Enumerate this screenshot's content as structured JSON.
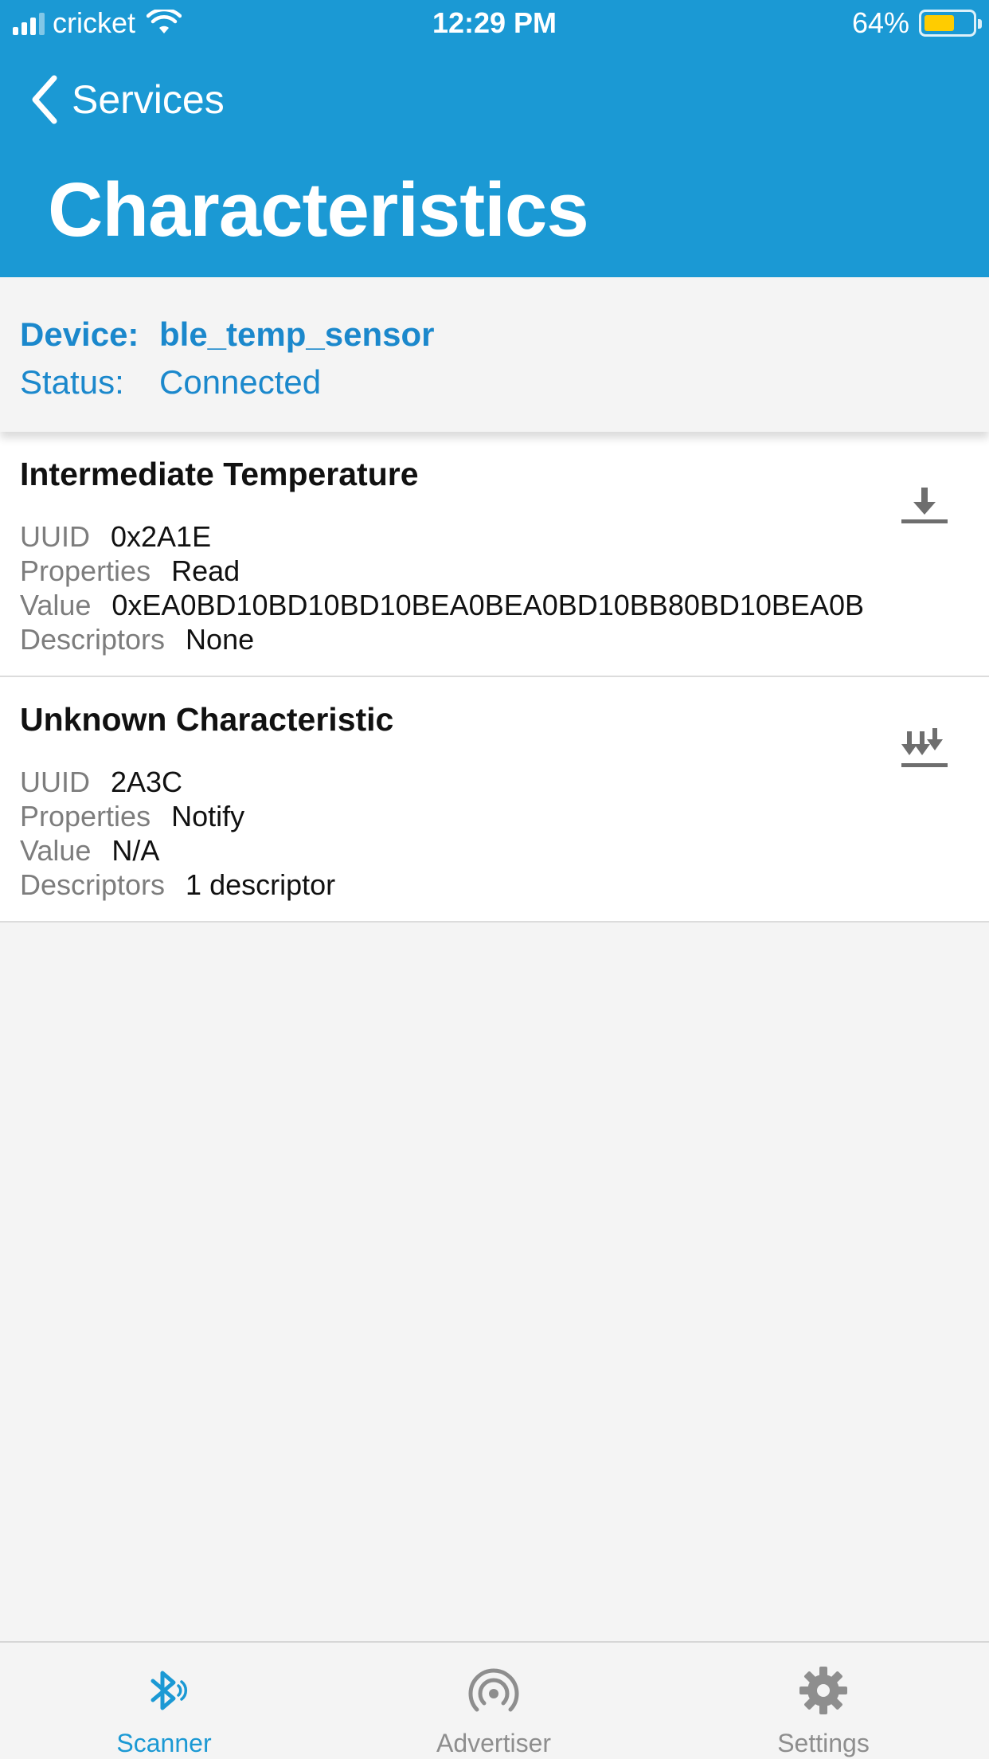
{
  "status_bar": {
    "carrier": "cricket",
    "time": "12:29 PM",
    "battery": "64%",
    "battery_level": 0.64
  },
  "nav": {
    "back_label": "Services",
    "title": "Characteristics"
  },
  "device": {
    "device_label": "Device:",
    "device_value": "ble_temp_sensor",
    "status_label": "Status:",
    "status_value": "Connected"
  },
  "characteristics": [
    {
      "name": "Intermediate Temperature",
      "uuid_label": "UUID",
      "uuid": "0x2A1E",
      "properties_label": "Properties",
      "properties": "Read",
      "value_label": "Value",
      "value": "0xEA0BD10BD10BD10BEA0BEA0BD10BB80BD10BEA0B",
      "descriptors_label": "Descriptors",
      "descriptors": "None",
      "action_icon": "download-icon"
    },
    {
      "name": "Unknown Characteristic",
      "uuid_label": "UUID",
      "uuid": "2A3C",
      "properties_label": "Properties",
      "properties": "Notify",
      "value_label": "Value",
      "value": "N/A",
      "descriptors_label": "Descriptors",
      "descriptors": "1 descriptor",
      "action_icon": "notify-download-icon"
    }
  ],
  "tabs": [
    {
      "label": "Scanner",
      "icon": "bluetooth-icon",
      "active": true
    },
    {
      "label": "Advertiser",
      "icon": "broadcast-icon",
      "active": false
    },
    {
      "label": "Settings",
      "icon": "gear-icon",
      "active": false
    }
  ],
  "colors": {
    "header": "#1b99d4",
    "accent_text": "#1b88cc",
    "battery": "#ffcc00"
  }
}
